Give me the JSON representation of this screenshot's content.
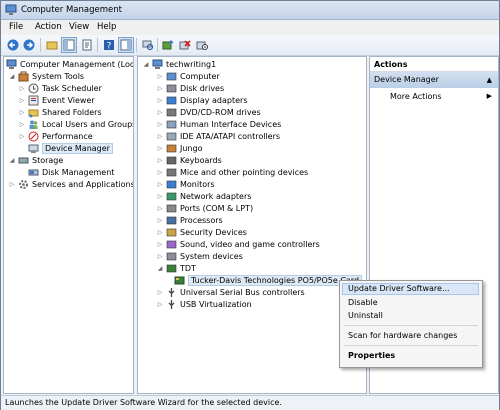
{
  "window": {
    "title": "Computer Management"
  },
  "menu": [
    "File",
    "Action",
    "View",
    "Help"
  ],
  "left_tree": {
    "root": "Computer Management (Local",
    "system_tools": "System Tools",
    "task_scheduler": "Task Scheduler",
    "event_viewer": "Event Viewer",
    "shared_folders": "Shared Folders",
    "local_users": "Local Users and Groups",
    "performance": "Performance",
    "device_manager": "Device Manager",
    "storage": "Storage",
    "disk_management": "Disk Management",
    "services": "Services and Applications"
  },
  "device_tree": {
    "root": "techwriting1",
    "categories": [
      "Computer",
      "Disk drives",
      "Display adapters",
      "DVD/CD-ROM drives",
      "Human Interface Devices",
      "IDE ATA/ATAPI controllers",
      "Jungo",
      "Keyboards",
      "Mice and other pointing devices",
      "Monitors",
      "Network adapters",
      "Ports (COM & LPT)",
      "Processors",
      "Security Devices",
      "Sound, video and game controllers",
      "System devices",
      "TDT"
    ],
    "tdt_child": "Tucker-Davis Technologies PO5/PO5e Card",
    "after": [
      "Universal Serial Bus controllers",
      "USB Virtualization"
    ]
  },
  "actions": {
    "header": "Actions",
    "group": "Device Manager",
    "more": "More Actions"
  },
  "context_menu": {
    "update": "Update Driver Software...",
    "disable": "Disable",
    "uninstall": "Uninstall",
    "scan": "Scan for hardware changes",
    "properties": "Properties"
  },
  "status": "Launches the Update Driver Software Wizard for the selected device."
}
